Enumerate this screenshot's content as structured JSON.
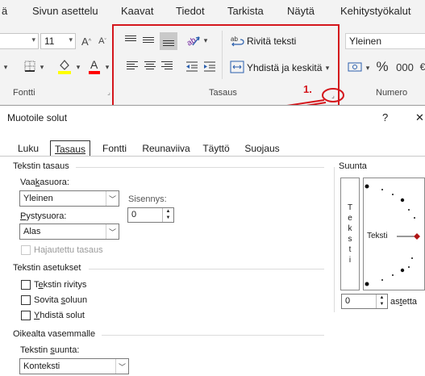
{
  "menu": {
    "tabs": [
      "ä",
      "Sivun asettelu",
      "Kaavat",
      "Tiedot",
      "Tarkista",
      "Näytä",
      "Kehitystyökalut"
    ]
  },
  "ribbon": {
    "font_size": "11",
    "font_group_label": "Fontti",
    "alignment_group_label": "Tasaus",
    "number_group_label": "Numero",
    "wrap_text_label": "Rivitä teksti",
    "merge_center_label": "Yhdistä ja keskitä",
    "number_format": "Yleinen",
    "percent_symbol": "%",
    "thousands_symbol": "000",
    "annotation_label": "1.",
    "colors": {
      "highlight": "#ffff00",
      "font_color": "#ff0000",
      "annotation": "#d4161c"
    },
    "icons": [
      "increase-font-icon",
      "decrease-font-icon",
      "borders-icon",
      "fill-color-icon",
      "font-color-icon",
      "align-top-icon",
      "align-middle-icon",
      "align-bottom-icon",
      "orientation-icon",
      "align-left-icon",
      "align-center-icon",
      "align-right-icon",
      "decrease-indent-icon",
      "increase-indent-icon",
      "wrap-text-icon",
      "merge-center-icon",
      "dialog-launcher-icon",
      "currency-icon",
      "percent-icon",
      "thousands-icon"
    ]
  },
  "dialog": {
    "title": "Muotoile solut",
    "help": "?",
    "close": "✕",
    "tabs": [
      "Luku",
      "Tasaus",
      "Fontti",
      "Reunaviiva",
      "Täyttö",
      "Suojaus"
    ],
    "active_tab": "Tasaus",
    "text_alignment": {
      "title": "Tekstin tasaus",
      "horizontal_label_pre": "Vaa",
      "horizontal_label_u": "k",
      "horizontal_label_post": "asuora:",
      "horizontal_value": "Yleinen",
      "indent_label": "Sisennys:",
      "indent_value": "0",
      "vertical_label_u": "P",
      "vertical_label_post": "ystysuora:",
      "vertical_value": "Alas",
      "distributed_label": "Hajautettu tasaus"
    },
    "text_control": {
      "title": "Tekstin asetukset",
      "wrap_pre": "T",
      "wrap_u": "e",
      "wrap_post": "kstin rivitys",
      "shrink_pre": "Sovita ",
      "shrink_u": "s",
      "shrink_post": "oluun",
      "merge_u": "Y",
      "merge_post": "hdistä solut"
    },
    "rtl": {
      "title": "Oikealta vasemmalle",
      "direction_label_pre": "Tekstin ",
      "direction_label_u": "s",
      "direction_label_post": "uunta:",
      "direction_value": "Konteksti"
    },
    "orientation": {
      "title": "Suunta",
      "vertical_text": [
        "T",
        "e",
        "k",
        "s",
        "t",
        "i"
      ],
      "dial_text": "Teksti",
      "degrees_value": "0",
      "degrees_label_pre": "as",
      "degrees_label_u": "t",
      "degrees_label_post": "etta"
    }
  }
}
